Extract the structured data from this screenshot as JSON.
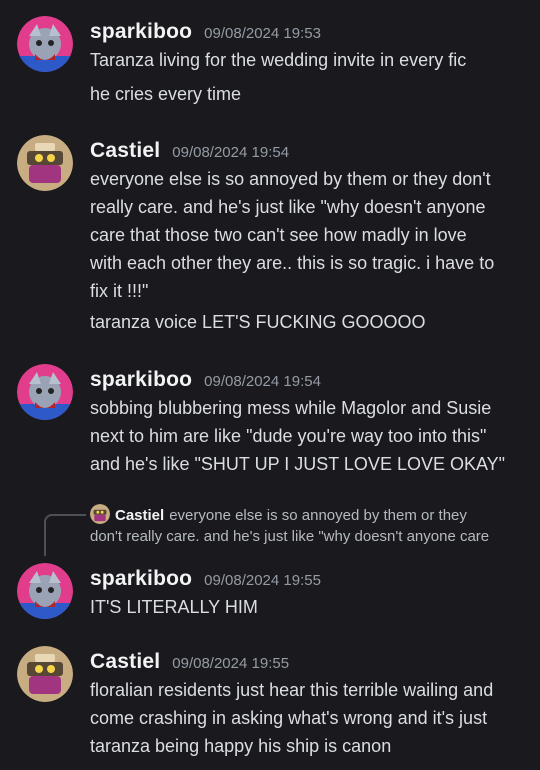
{
  "messages": [
    {
      "author": "sparkiboo",
      "timestamp": "09/08/2024 19:53",
      "lines": [
        "Taranza living for the wedding invite in every fic"
      ],
      "followup": "he cries every time"
    },
    {
      "author": "Castiel",
      "timestamp": "09/08/2024 19:54",
      "lines": [
        "everyone else is so annoyed by them or they don't",
        "really care. and he's just like \"why doesn't anyone",
        "care that those two can't see how madly in love",
        "with each other they are.. this is so tragic. i have to",
        "fix it !!!\""
      ],
      "followup": "taranza voice LET'S FUCKING GOOOOO"
    },
    {
      "author": "sparkiboo",
      "timestamp": "09/08/2024 19:54",
      "lines": [
        "sobbing blubbering mess while Magolor and Susie",
        "next to him are like \"dude you're way too into this\"",
        "and he's like \"SHUT UP I JUST LOVE LOVE OKAY\""
      ]
    },
    {
      "author": "sparkiboo",
      "timestamp": "09/08/2024 19:55",
      "lines": [
        "IT'S LITERALLY HIM"
      ],
      "reply": {
        "author": "Castiel",
        "line1": "everyone else is so annoyed by them or they",
        "line2": "don't really care. and he's just like \"why doesn't anyone care"
      }
    },
    {
      "author": "Castiel",
      "timestamp": "09/08/2024 19:55",
      "lines": [
        "floralian residents just hear this terrible wailing and",
        "come crashing in asking what's wrong and it's just",
        "taranza being happy his ship is canon"
      ]
    }
  ],
  "colors": {
    "background": "#1a1a1e",
    "name": "#f2f3f5",
    "timestamp": "#949ba4",
    "text": "#dbdee1"
  },
  "icons": {
    "sparkiboo_avatar": "taranza-avatar-icon",
    "castiel_avatar": "magolor-avatar-icon"
  }
}
